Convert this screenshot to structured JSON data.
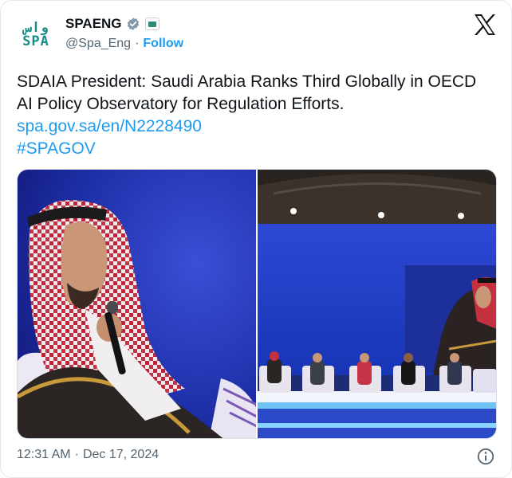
{
  "account": {
    "logo_line_1": "واس",
    "logo_line_2": "SPA",
    "name": "SPAENG",
    "handle": "@Spa_Eng",
    "separator": "·",
    "follow_label": "Follow"
  },
  "icons": {
    "verified": "verified-check-icon",
    "government": "government-badge-icon",
    "platform": "x-logo-icon",
    "info": "info-icon"
  },
  "tweet": {
    "text": "SDAIA President: Saudi Arabia Ranks Third Globally in OECD AI Policy Observatory for Regulation Efforts.",
    "link": "spa.gov.sa/en/N2228490",
    "hashtag": "#SPAGOV"
  },
  "media": {
    "photo_1": "speaker-photo",
    "photo_2": "panel-stage-photo"
  },
  "meta": {
    "time": "12:31 AM",
    "separator": "·",
    "date": "Dec 17, 2024"
  },
  "colors": {
    "link": "#1d9bf0",
    "muted": "#536471",
    "text": "#0f1419",
    "logo": "#1a8c86",
    "verified": "#829aab",
    "stage_blue": "#1f3fb8"
  }
}
